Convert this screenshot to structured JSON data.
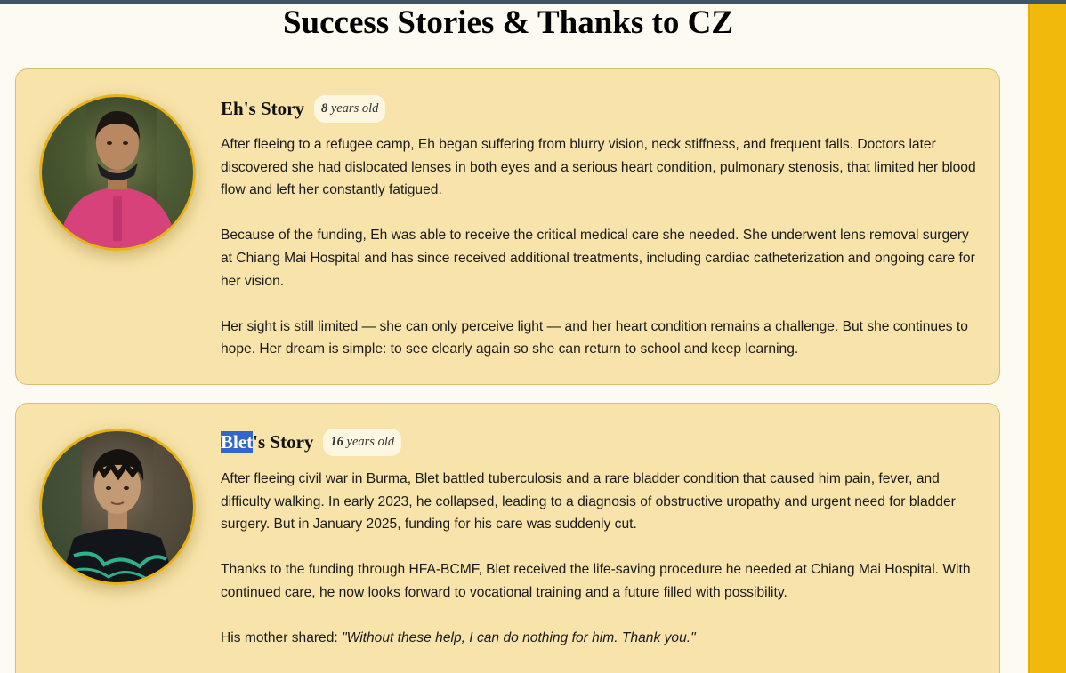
{
  "page": {
    "title": "Success Stories & Thanks to CZ"
  },
  "colors": {
    "card_background": "#f8e4aa",
    "accent_rail": "#f0b90b",
    "avatar_ring": "#e8b319",
    "selection_highlight": "#3366cc"
  },
  "stories": [
    {
      "name": "Eh",
      "title_suffix": "'s Story",
      "age_number": "8",
      "age_suffix": " years old",
      "photo": "portrait-girl-pink-dress",
      "paragraphs": [
        "After fleeing to a refugee camp, Eh began suffering from blurry vision, neck stiffness, and frequent falls. Doctors later discovered she had dislocated lenses in both eyes and a serious heart condition, pulmonary stenosis, that limited her blood flow and left her constantly fatigued.",
        "Because of the funding, Eh was able to receive the critical medical care she needed. She underwent lens removal surgery at Chiang Mai Hospital and has since received additional treatments, including cardiac catheterization and ongoing care for her vision.",
        "Her sight is still limited — she can only perceive light — and her heart condition remains a challenge. But she continues to hope. Her dream is simple: to see clearly again so she can return to school and keep learning."
      ]
    },
    {
      "name": "Blet",
      "title_suffix": "'s Story",
      "age_number": "16",
      "age_suffix": " years old",
      "photo": "portrait-boy-dark-shirt",
      "paragraphs": [
        "After fleeing civil war in Burma, Blet battled tuberculosis and a rare bladder condition that caused him pain, fever, and difficulty walking. In early 2023, he collapsed, leading to a diagnosis of obstructive uropathy and urgent need for bladder surgery. But in January 2025, funding for his care was suddenly cut.",
        "Thanks to the funding through HFA-BCMF, Blet received the life-saving procedure he needed at Chiang Mai Hospital. With continued care, he now looks forward to vocational training and a future filled with possibility."
      ],
      "quote_lead": "His mother shared: ",
      "quote": "\"Without these help, I can do nothing for him. Thank you.\""
    }
  ]
}
